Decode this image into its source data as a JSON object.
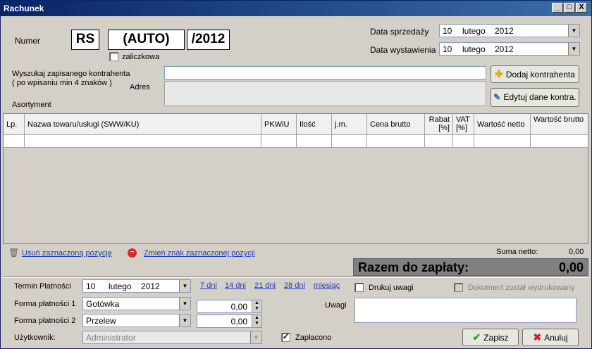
{
  "window": {
    "title": "Rachunek",
    "min": "_",
    "max": "□",
    "close": "X"
  },
  "numer": {
    "label": "Numer",
    "prefix": "RS",
    "value": "(AUTO)",
    "suffix": "/2012",
    "zaliczkowa_label": "zaliczkowa"
  },
  "dates": {
    "sale_label": "Data sprzedaży",
    "sale": {
      "day": "10",
      "month": "lutego",
      "year": "2012"
    },
    "issue_label": "Data wystawienia",
    "issue": {
      "day": "10",
      "month": "lutego",
      "year": "2012"
    }
  },
  "kontrahent": {
    "search_label_1": "Wyszukaj zapisanego kontrahenta",
    "search_label_2": "( po wpisaniu min 4 znaków )",
    "adres_label": "Adres",
    "add_button": "Dodaj kontrahenta",
    "edit_button": "Edytuj dane kontra."
  },
  "asortyment": {
    "label": "Asortyment",
    "columns": [
      "Lp.",
      "Nazwa towaru/usługi (SWW/KU)",
      "PKWiU",
      "Ilość",
      "j.m.",
      "Cena brutto",
      "Rabat [%]",
      "VAT [%]",
      "Wartość netto",
      "Wartość brutto"
    ]
  },
  "actions": {
    "remove": "Usuń zaznaczoną pozycję",
    "change_sign": "Zmień znak zaznaczonej pozycji"
  },
  "totals": {
    "suma_netto_label": "Suma netto:",
    "suma_netto": "0,00",
    "razem_label": "Razem do zapłaty:",
    "razem": "0,00"
  },
  "payment": {
    "termin_label": "Termin Płatności",
    "termin": {
      "day": "10",
      "month": "lutego",
      "year": "2012"
    },
    "quick_links": [
      "7 dni",
      "14 dni",
      "21 dni",
      "28 dni",
      "miesiąc"
    ],
    "forma1_label": "Forma płatności 1",
    "forma1": "Gotówka",
    "forma1_amount": "0,00",
    "forma2_label": "Forma płatności 2",
    "forma2": "Przelew",
    "forma2_amount": "0,00",
    "user_label": "Użytkownik:",
    "user": "Administrator",
    "zaplacono_label": "Zapłacono",
    "drukuj_label": "Drukuj uwagi",
    "wydrukowany_label": "Dokument został wydrukowany",
    "uwagi_label": "Uwagi"
  },
  "buttons": {
    "save": "Zapisz",
    "cancel": "Anuluj"
  },
  "colors": {
    "title_bar": "#0a246a",
    "total_bar": "#808080",
    "link": "#1a3dbd"
  }
}
